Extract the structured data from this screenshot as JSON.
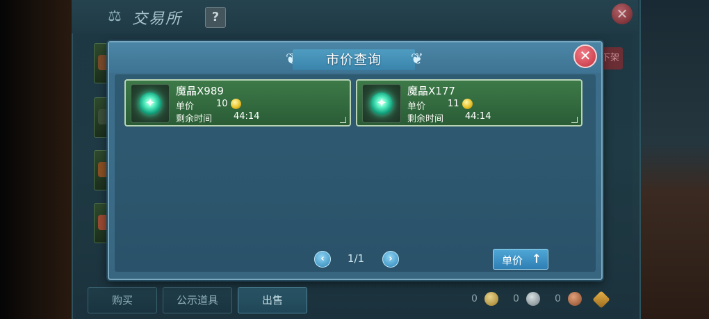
{
  "background": {
    "exchange_title": "交易所",
    "help_label": "?",
    "close_glyph": "✕",
    "delist_label": "下架",
    "tabs": [
      {
        "label": "购买",
        "active": false
      },
      {
        "label": "公示道具",
        "active": false
      },
      {
        "label": "出售",
        "active": true
      }
    ],
    "currencies": [
      {
        "amount": "0",
        "icon": "gold-coin-icon"
      },
      {
        "amount": "0",
        "icon": "silver-coin-icon"
      },
      {
        "amount": "0",
        "icon": "copper-coin-icon"
      }
    ]
  },
  "dialog": {
    "title": "市价查询",
    "close_glyph": "✕",
    "listings": [
      {
        "name": "魔晶X989",
        "price_label": "单价",
        "price": "10",
        "time_label": "剩余时间",
        "time": "44:14",
        "icon": "magic-crystal-icon"
      },
      {
        "name": "魔晶X177",
        "price_label": "单价",
        "price": "11",
        "time_label": "剩余时间",
        "time": "44:14",
        "icon": "magic-crystal-icon"
      }
    ],
    "pagination": {
      "prev_glyph": "‹",
      "next_glyph": "›",
      "indicator": "1/1"
    },
    "sort": {
      "label": "单价",
      "arrow_glyph": "↑"
    }
  },
  "colors": {
    "dialog_bg": "#3c6e8a",
    "card_green": "#2a5c36",
    "close_red": "#c2303d",
    "accent_blue": "#2f7fb4"
  }
}
